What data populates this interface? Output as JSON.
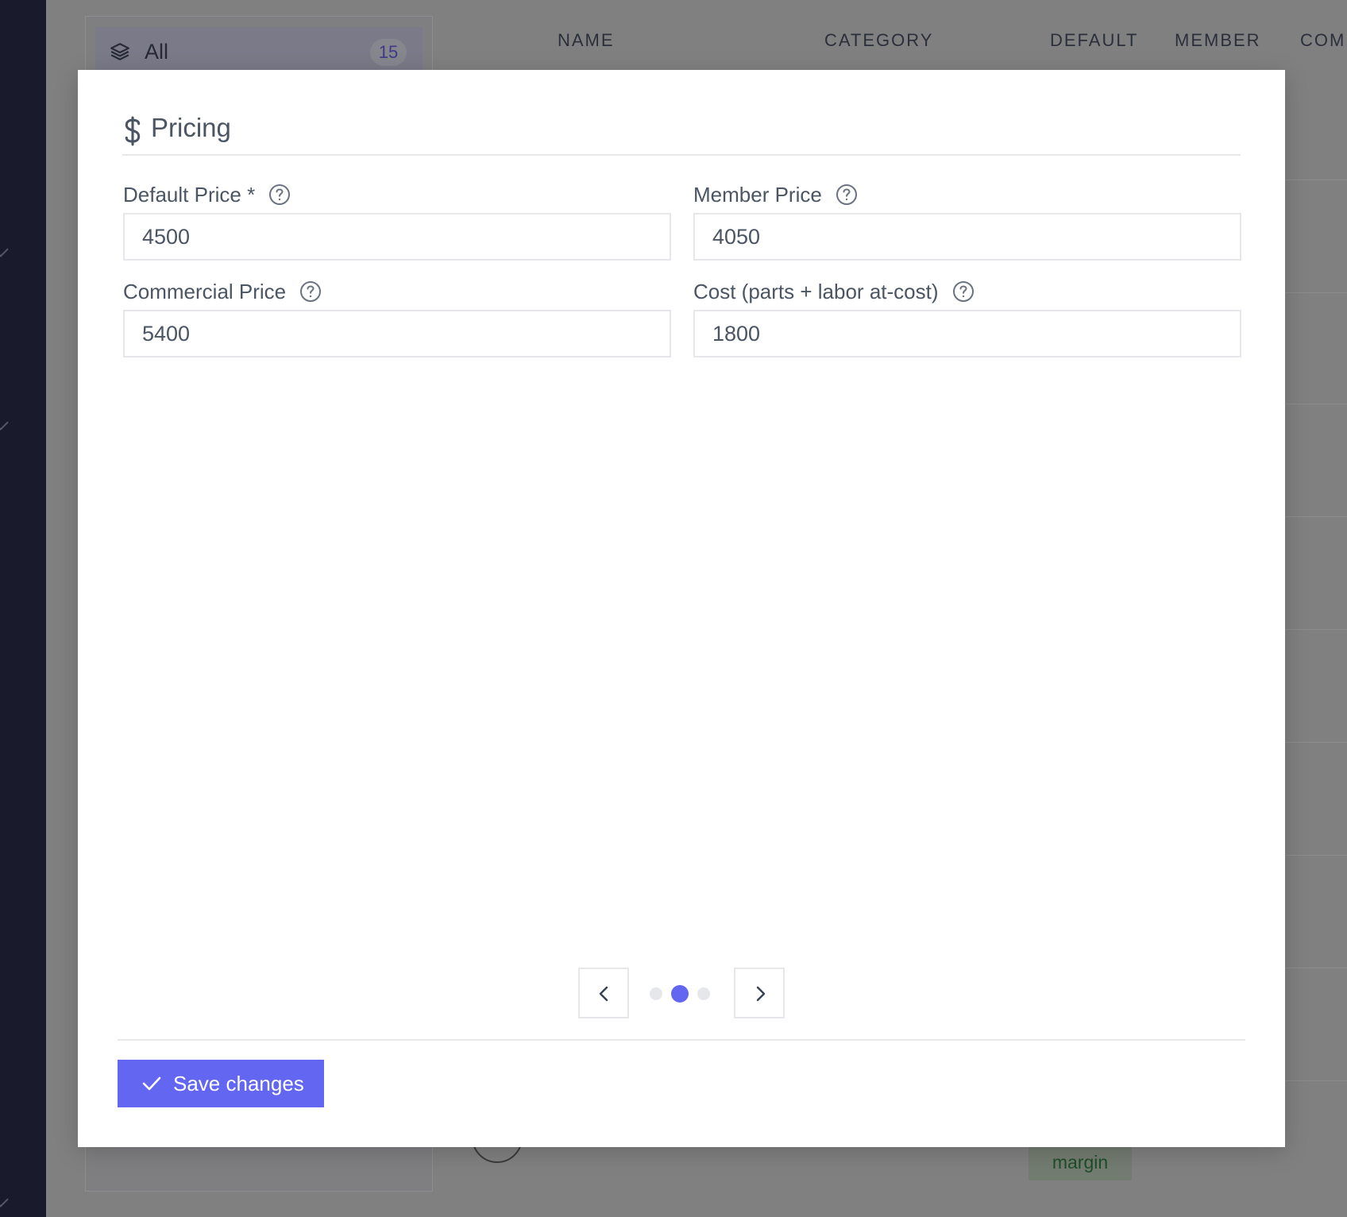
{
  "background": {
    "filter": {
      "label": "All",
      "count": "15"
    },
    "table_headers": [
      "NAME",
      "CATEGORY",
      "DEFAULT",
      "MEMBER",
      "COMM"
    ],
    "row_tag": "margin"
  },
  "modal": {
    "section_icon": "dollar-icon",
    "section_title": "Pricing",
    "fields": {
      "default_price": {
        "label": "Default Price *",
        "value": "4500"
      },
      "member_price": {
        "label": "Member Price",
        "value": "4050"
      },
      "commercial_price": {
        "label": "Commercial Price",
        "value": "5400"
      },
      "cost": {
        "label": "Cost (parts + labor at-cost)",
        "value": "1800"
      }
    },
    "pager": {
      "pages": 3,
      "current_page": 2
    },
    "save_label": "Save changes"
  },
  "colors": {
    "accent": "#6366f1",
    "sidebar": "#191a2b",
    "overlay": "#808080"
  }
}
